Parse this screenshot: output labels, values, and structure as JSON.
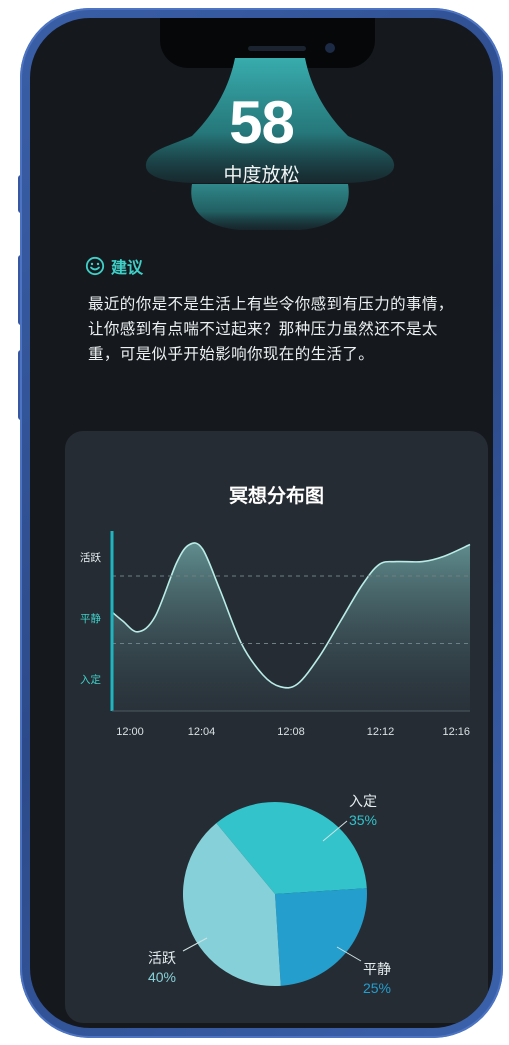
{
  "score": {
    "value": "58",
    "label": "中度放松"
  },
  "suggestion": {
    "title": "建议",
    "text": "最近的你是不是生活上有些令你感到有压力的事情，让你感到有点喘不过起来？那种压力虽然还不是太重，可是似乎开始影响你现在的生活了。"
  },
  "chart_card": {
    "title": "冥想分布图"
  },
  "chart_data": [
    {
      "type": "area",
      "y_categories": [
        "活跃",
        "平静",
        "入定"
      ],
      "x_ticks": [
        "12:00",
        "12:04",
        "12:08",
        "12:12",
        "12:16"
      ],
      "x": [
        0,
        0.5,
        1.2,
        2,
        3,
        3.6,
        4.2,
        5,
        6,
        7,
        7.8,
        8.6,
        9.6,
        10.6,
        11.6,
        12.4,
        13.2,
        14.4,
        15.4,
        16.6
      ],
      "y": [
        1.1,
        1.0,
        0.88,
        1.05,
        1.65,
        1.85,
        1.8,
        1.35,
        0.75,
        0.4,
        0.27,
        0.3,
        0.6,
        1.0,
        1.4,
        1.63,
        1.66,
        1.66,
        1.72,
        1.85
      ],
      "xlim": [
        0,
        16.6
      ],
      "ylim": [
        0,
        2
      ],
      "reference_lines": [
        1.5,
        0.75
      ]
    },
    {
      "type": "pie",
      "slices": [
        {
          "label": "入定",
          "value": 35,
          "display": "35%",
          "color": "#32c3cb"
        },
        {
          "label": "平静",
          "value": 25,
          "display": "25%",
          "color": "#239ecd"
        },
        {
          "label": "活跃",
          "value": 40,
          "display": "40%",
          "color": "#86d1d9"
        }
      ]
    }
  ],
  "colors": {
    "accent": "#3fd0c8",
    "screen_bg": "#15191e",
    "card_bg": "#262c34"
  }
}
